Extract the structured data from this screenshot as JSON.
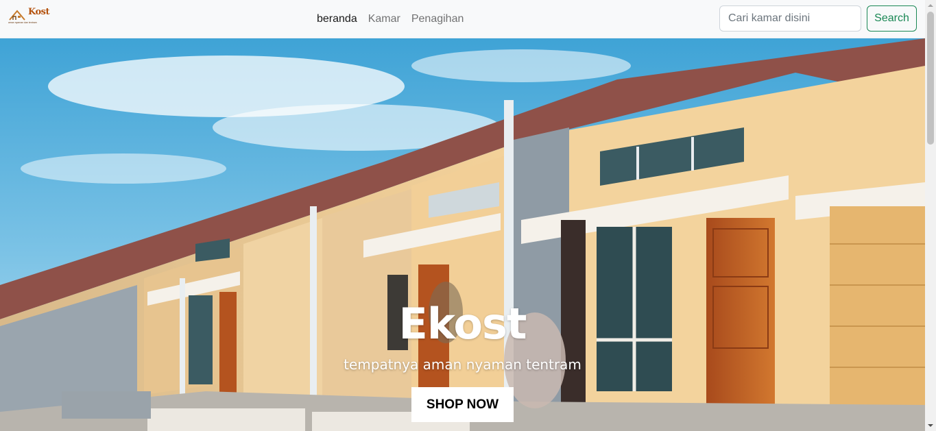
{
  "brand": {
    "name": "Kost",
    "tagline": "aman nyaman dan tentram"
  },
  "nav": {
    "items": [
      {
        "label": "beranda",
        "active": true
      },
      {
        "label": "Kamar",
        "active": false
      },
      {
        "label": "Penagihan",
        "active": false
      }
    ]
  },
  "search": {
    "placeholder": "Cari kamar disini",
    "value": "",
    "button_label": "Search"
  },
  "hero": {
    "title": "Ekost",
    "subtitle": "tempatnya aman nyaman tentram",
    "cta_label": "SHOP NOW"
  },
  "colors": {
    "navbar_bg": "#f8f9fa",
    "search_accent": "#198754",
    "brand": "#b4520e"
  }
}
